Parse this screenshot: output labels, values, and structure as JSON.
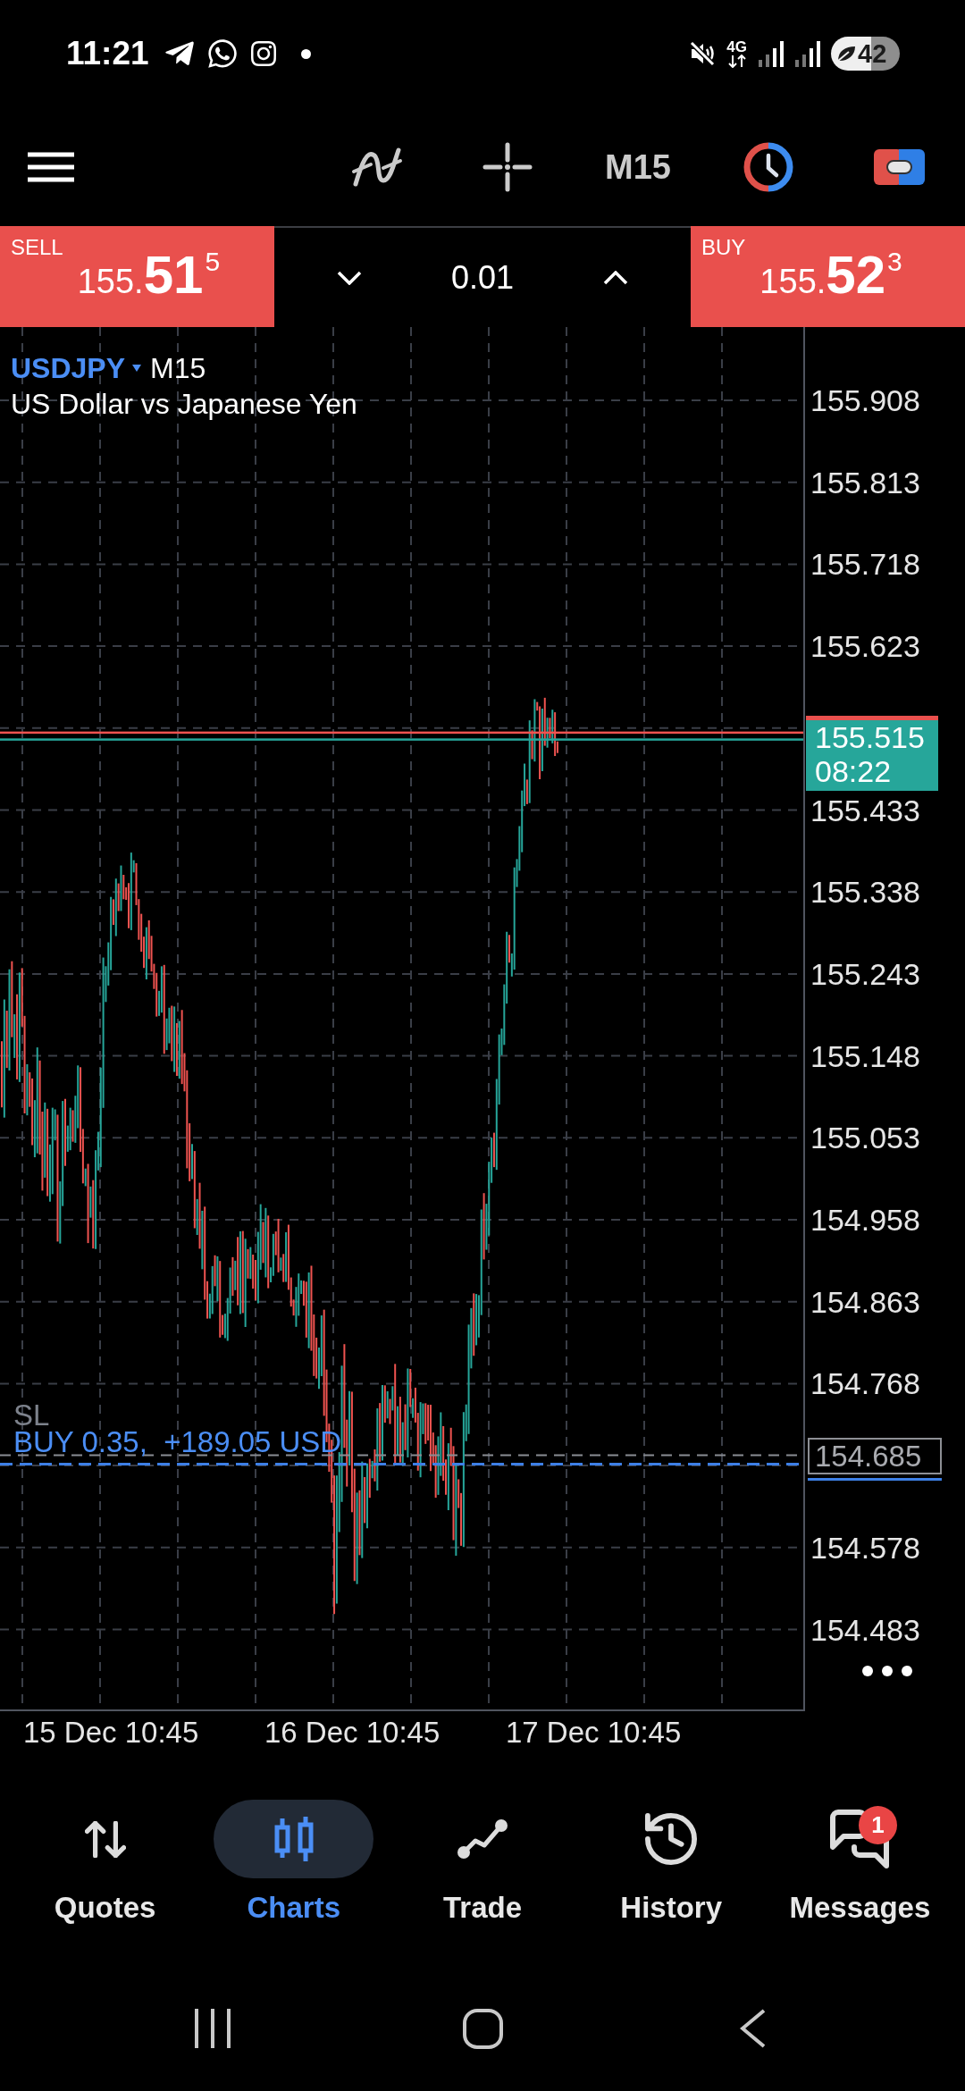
{
  "status_bar": {
    "time": "11:21",
    "network_type": "4G",
    "battery": "42"
  },
  "toolbar": {
    "timeframe": "M15"
  },
  "trade_panel": {
    "sell": {
      "label": "SELL",
      "price_lead": "155.",
      "price_big": "51",
      "price_sup": "5"
    },
    "volume": "0.01",
    "buy": {
      "label": "BUY",
      "price_lead": "155.",
      "price_big": "52",
      "price_sup": "3"
    }
  },
  "chart": {
    "symbol": "USDJPY",
    "timeframe": "M15",
    "description": "US Dollar vs Japanese Yen",
    "price_ticks": [
      "155.908",
      "155.813",
      "155.718",
      "155.623",
      "155.433",
      "155.338",
      "155.243",
      "155.148",
      "155.053",
      "154.958",
      "154.863",
      "154.768",
      "154.578",
      "154.483"
    ],
    "time_labels": [
      "15 Dec 10:45",
      "16 Dec 10:45",
      "17 Dec 10:45"
    ],
    "current_price": {
      "price": "155.515",
      "countdown": "08:22"
    },
    "position": {
      "stop_label": "SL",
      "label": "BUY 0.35,  +189.05 USD",
      "price": "154.685"
    }
  },
  "bottom_nav": [
    {
      "label": "Quotes",
      "selected": false
    },
    {
      "label": "Charts",
      "selected": true
    },
    {
      "label": "Trade",
      "selected": false
    },
    {
      "label": "History",
      "selected": false
    },
    {
      "label": "Messages",
      "selected": false,
      "badge": "1"
    }
  ]
}
